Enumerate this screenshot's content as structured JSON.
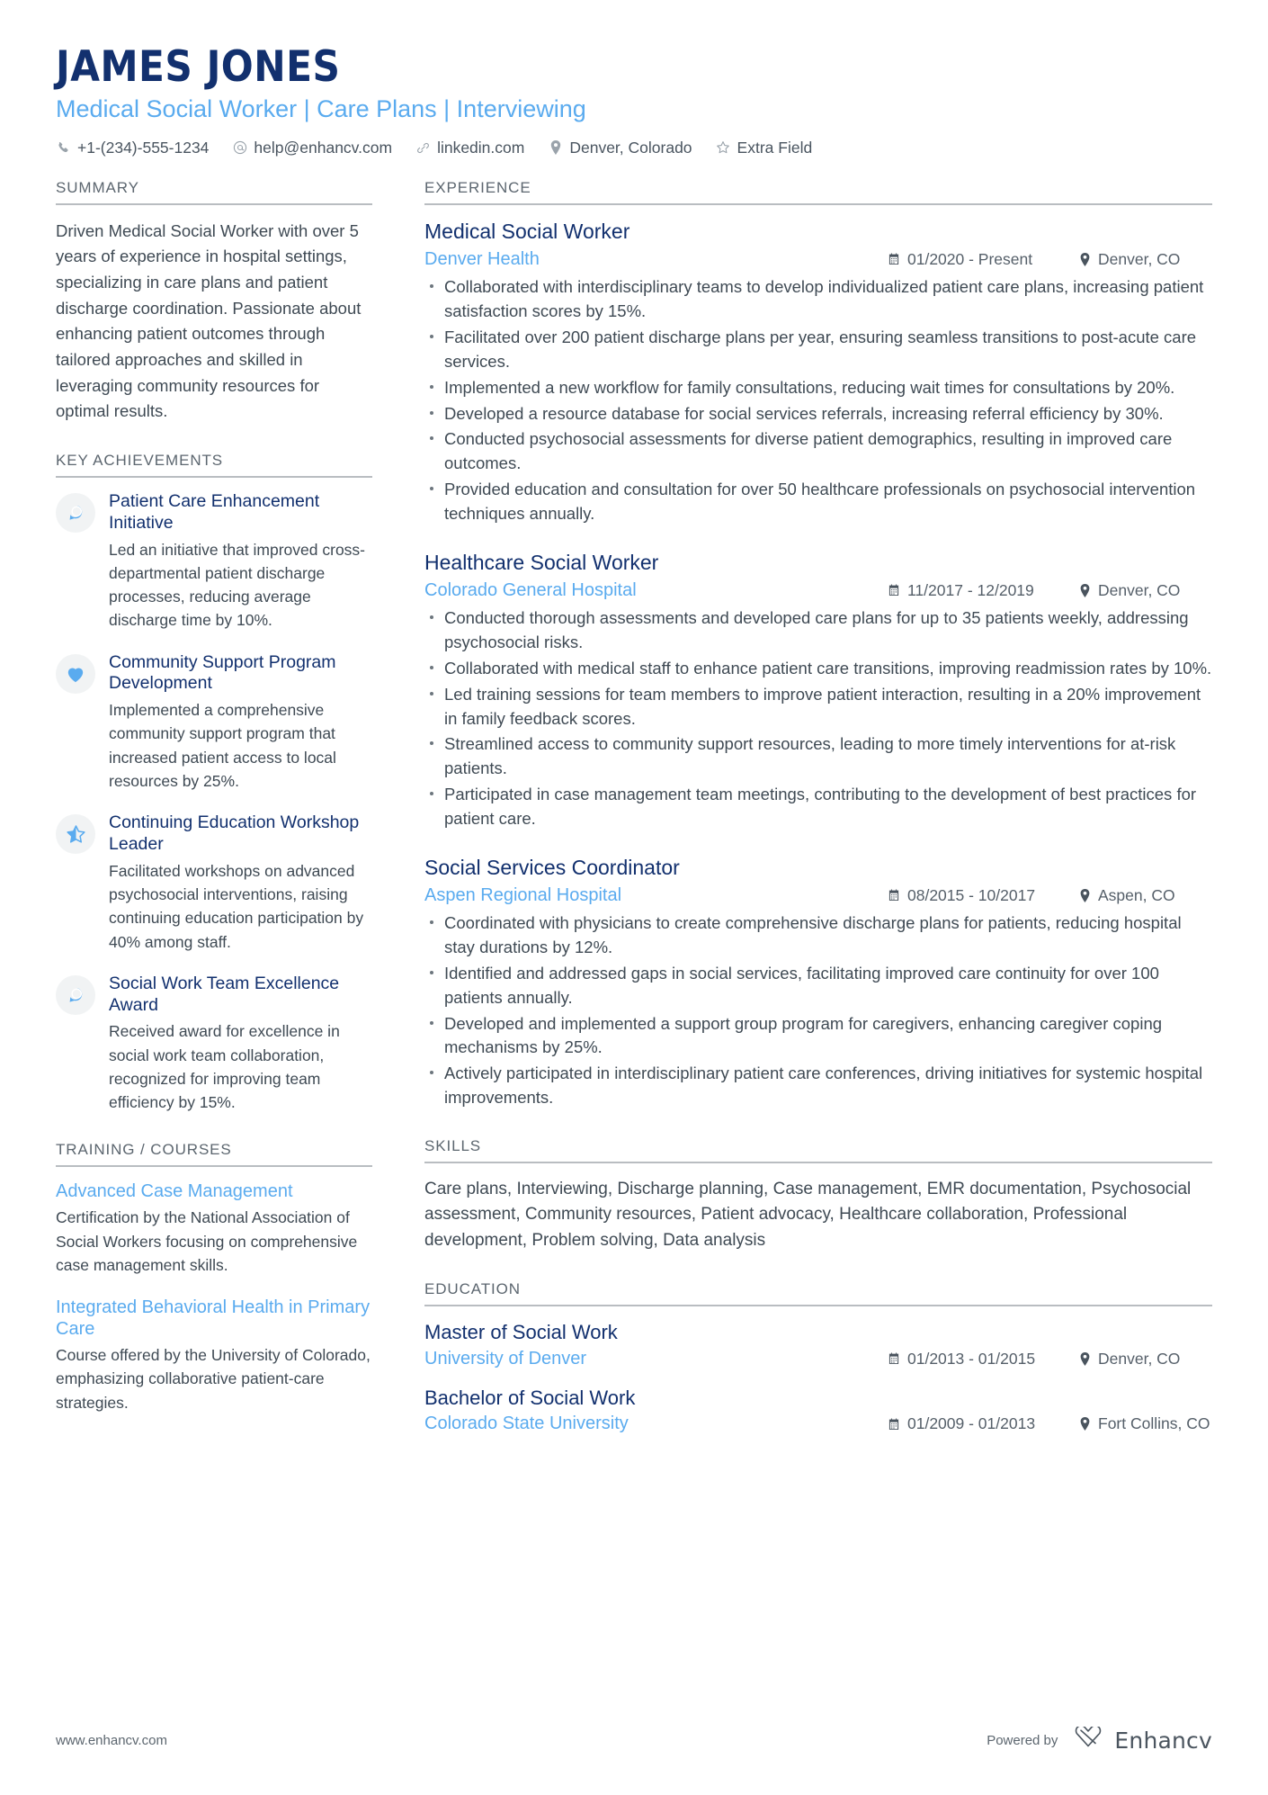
{
  "header": {
    "name": "JAMES JONES",
    "subtitle": "Medical Social Worker | Care Plans | Interviewing",
    "contacts": [
      {
        "icon": "phone-icon",
        "text": "+1-(234)-555-1234"
      },
      {
        "icon": "email-icon",
        "text": "help@enhancv.com"
      },
      {
        "icon": "link-icon",
        "text": "linkedin.com"
      },
      {
        "icon": "location-pin-icon",
        "text": "Denver, Colorado"
      },
      {
        "icon": "star-icon",
        "text": "Extra Field"
      }
    ]
  },
  "left": {
    "summary": {
      "heading": "SUMMARY",
      "text": "Driven Medical Social Worker with over 5 years of experience in hospital settings, specializing in care plans and patient discharge coordination. Passionate about enhancing patient outcomes through tailored approaches and skilled in leveraging community resources for optimal results."
    },
    "achievements": {
      "heading": "KEY ACHIEVEMENTS",
      "items": [
        {
          "icon": "speech-bubble-icon",
          "title": "Patient Care Enhancement Initiative",
          "desc": "Led an initiative that improved cross-departmental patient discharge processes, reducing average discharge time by 10%."
        },
        {
          "icon": "heart-icon",
          "title": "Community Support Program Development",
          "desc": "Implemented a comprehensive community support program that increased patient access to local resources by 25%."
        },
        {
          "icon": "half-star-icon",
          "title": "Continuing Education Workshop Leader",
          "desc": "Facilitated workshops on advanced psychosocial interventions, raising continuing education participation by 40% among staff."
        },
        {
          "icon": "speech-bubble-icon",
          "title": "Social Work Team Excellence Award",
          "desc": "Received award for excellence in social work team collaboration, recognized for improving team efficiency by 15%."
        }
      ]
    },
    "training": {
      "heading": "TRAINING / COURSES",
      "items": [
        {
          "title": "Advanced Case Management",
          "desc": "Certification by the National Association of Social Workers focusing on comprehensive case management skills."
        },
        {
          "title": "Integrated Behavioral Health in Primary Care",
          "desc": "Course offered by the University of Colorado, emphasizing collaborative patient-care strategies."
        }
      ]
    }
  },
  "right": {
    "experience": {
      "heading": "EXPERIENCE",
      "jobs": [
        {
          "title": "Medical Social Worker",
          "company": "Denver Health",
          "dates": "01/2020 - Present",
          "location": "Denver, CO",
          "bullets": [
            "Collaborated with interdisciplinary teams to develop individualized patient care plans, increasing patient satisfaction scores by 15%.",
            "Facilitated over 200 patient discharge plans per year, ensuring seamless transitions to post-acute care services.",
            "Implemented a new workflow for family consultations, reducing wait times for consultations by 20%.",
            "Developed a resource database for social services referrals, increasing referral efficiency by 30%.",
            "Conducted psychosocial assessments for diverse patient demographics, resulting in improved care outcomes.",
            "Provided education and consultation for over 50 healthcare professionals on psychosocial intervention techniques annually."
          ]
        },
        {
          "title": "Healthcare Social Worker",
          "company": "Colorado General Hospital",
          "dates": "11/2017 - 12/2019",
          "location": "Denver, CO",
          "bullets": [
            "Conducted thorough assessments and developed care plans for up to 35 patients weekly, addressing psychosocial risks.",
            "Collaborated with medical staff to enhance patient care transitions, improving readmission rates by 10%.",
            "Led training sessions for team members to improve patient interaction, resulting in a 20% improvement in family feedback scores.",
            "Streamlined access to community support resources, leading to more timely interventions for at-risk patients.",
            "Participated in case management team meetings, contributing to the development of best practices for patient care."
          ]
        },
        {
          "title": "Social Services Coordinator",
          "company": "Aspen Regional Hospital",
          "dates": "08/2015 - 10/2017",
          "location": "Aspen, CO",
          "bullets": [
            "Coordinated with physicians to create comprehensive discharge plans for patients, reducing hospital stay durations by 12%.",
            "Identified and addressed gaps in social services, facilitating improved care continuity for over 100 patients annually.",
            "Developed and implemented a support group program for caregivers, enhancing caregiver coping mechanisms by 25%.",
            "Actively participated in interdisciplinary patient care conferences, driving initiatives for systemic hospital improvements."
          ]
        }
      ]
    },
    "skills": {
      "heading": "SKILLS",
      "text": "Care plans, Interviewing, Discharge planning, Case management, EMR documentation, Psychosocial assessment, Community resources, Patient advocacy, Healthcare collaboration, Professional development, Problem solving, Data analysis"
    },
    "education": {
      "heading": "EDUCATION",
      "items": [
        {
          "degree": "Master of Social Work",
          "school": "University of Denver",
          "dates": "01/2013 - 01/2015",
          "location": "Denver, CO"
        },
        {
          "degree": "Bachelor of Social Work",
          "school": "Colorado State University",
          "dates": "01/2009 - 01/2013",
          "location": "Fort Collins, CO"
        }
      ]
    }
  },
  "footer": {
    "website": "www.enhancv.com",
    "powered_by": "Powered by",
    "brand": "Enhancv"
  },
  "colors": {
    "navy": "#12306e",
    "light_blue": "#5aabef",
    "body_text": "#3f4a54",
    "rule": "#b9bdc1"
  }
}
